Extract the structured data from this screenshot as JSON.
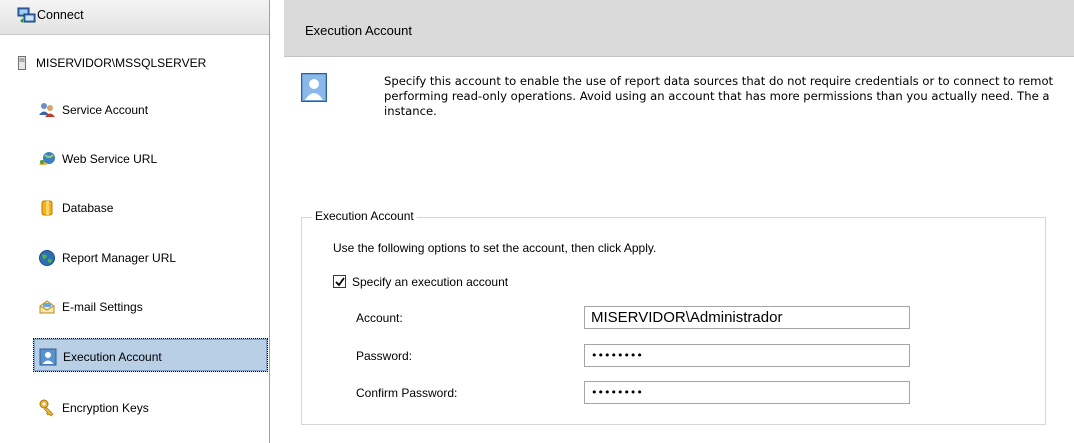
{
  "sidebar": {
    "connect_label": "Connect",
    "server_name": "MISERVIDOR\\MSSQLSERVER",
    "items": [
      {
        "label": "Service Account",
        "icon": "users-icon"
      },
      {
        "label": "Web Service URL",
        "icon": "web-service-icon"
      },
      {
        "label": "Database",
        "icon": "database-icon"
      },
      {
        "label": "Report Manager URL",
        "icon": "globe-icon"
      },
      {
        "label": "E-mail Settings",
        "icon": "email-icon"
      },
      {
        "label": "Execution Account",
        "icon": "user-account-icon",
        "selected": true
      },
      {
        "label": "Encryption Keys",
        "icon": "key-icon"
      }
    ]
  },
  "main": {
    "title": "Execution Account",
    "intro_line1": "Specify this account to enable the use of report data sources that do not require credentials or to connect to remot",
    "intro_line2": "performing read-only operations. Avoid using an account that has more permissions than you actually need. The a",
    "intro_line3": "instance.",
    "group": {
      "legend": "Execution Account",
      "instructions": "Use the following options to set the account, then click Apply.",
      "specify_label": "Specify an execution account",
      "specify_checked": true,
      "account_label": "Account:",
      "account_value": "MISERVIDOR\\Administrador",
      "password_label": "Password:",
      "password_value": "••••••••",
      "confirm_label": "Confirm Password:",
      "confirm_value": "••••••••"
    }
  },
  "colors": {
    "selected_bg": "#b8cfe6",
    "header_bg": "#dadada"
  }
}
